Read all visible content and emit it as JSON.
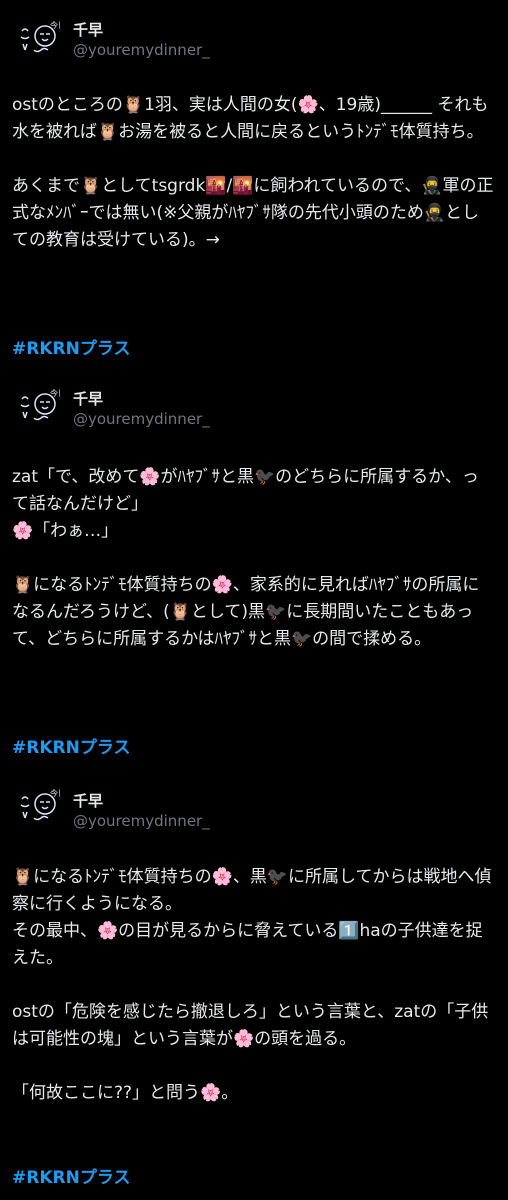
{
  "posts": [
    {
      "author": {
        "name": "千早",
        "handle": "@youremydinner_"
      },
      "text": "ostのところの🦉1羽、実は人間の女(🌸、19歳)______ それも水を被れば🦉お湯を被ると人間に戻るというﾄﾝﾃﾞﾓ体質持ち。\n\nあくまで🦉としてtsgrdk🌇/🌇に飼われているので、🥷軍の正式なﾒﾝﾊﾞｰでは無い(※父親がﾊﾔﾌﾞｻ隊の先代小頭のため🥷としての教育は受けている)。→",
      "hashtag": "#RKRNプラス"
    },
    {
      "author": {
        "name": "千早",
        "handle": "@youremydinner_"
      },
      "text": "zat「で、改めて🌸がﾊﾔﾌﾞｻと黒🐦‍⬛のどちらに所属するか、って話なんだけど」\n🌸「わぁ…」\n\n🦉になるﾄﾝﾃﾞﾓ体質持ちの🌸、家系的に見ればﾊﾔﾌﾞｻの所属になるんだろうけど、(🦉として)黒🐦‍⬛に長期間いたこともあって、どちらに所属するかはﾊﾔﾌﾞｻと黒🐦‍⬛の間で揉める。",
      "hashtag": "#RKRNプラス"
    },
    {
      "author": {
        "name": "千早",
        "handle": "@youremydinner_"
      },
      "text": "🦉になるﾄﾝﾃﾞﾓ体質持ちの🌸、黒🐦‍⬛に所属してからは戦地へ偵察に行くようになる。\nその最中、🌸の目が見るからに脅えている1️⃣haの子供達を捉えた。\n\nostの「危険を感じたら撤退しろ」という言葉と、zatの「子供は可能性の塊」という言葉が🌸の頭を過る。\n\n「何故ここに??」と問う🌸。",
      "hashtag": "#RKRNプラス"
    }
  ]
}
